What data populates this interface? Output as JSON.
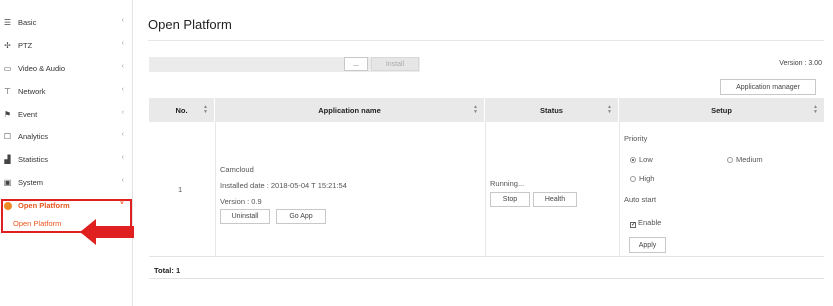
{
  "sidebar": {
    "items": [
      {
        "label": "Basic",
        "icon": "list-icon",
        "glyph": "☰"
      },
      {
        "label": "PTZ",
        "icon": "ptz-move-icon",
        "glyph": "✢"
      },
      {
        "label": "Video & Audio",
        "icon": "video-icon",
        "glyph": "▭"
      },
      {
        "label": "Network",
        "icon": "network-icon",
        "glyph": "⊤"
      },
      {
        "label": "Event",
        "icon": "event-icon",
        "glyph": "⚑"
      },
      {
        "label": "Analytics",
        "icon": "analytics-icon",
        "glyph": "☐"
      },
      {
        "label": "Statistics",
        "icon": "statistics-icon",
        "glyph": "▟"
      },
      {
        "label": "System",
        "icon": "system-icon",
        "glyph": "▣"
      },
      {
        "label": "Open Platform",
        "icon": "open-platform-icon",
        "glyph": ""
      }
    ],
    "chevron": "‹",
    "chevron_open": "˅",
    "sub_item": "Open Platform"
  },
  "page": {
    "title": "Open Platform"
  },
  "toolbar": {
    "browse_label": "...",
    "install_label": "Install",
    "version": "Version : 3.00",
    "app_manager_label": "Application manager"
  },
  "table": {
    "headers": {
      "no": "No.",
      "name": "Application name",
      "status": "Status",
      "setup": "Setup"
    },
    "row": {
      "no": "1",
      "app_name": "Camcloud",
      "installed_date": "Installed date : 2018-05-04 T 15:21:54",
      "version": "Version : 0.9",
      "uninstall_label": "Uninstall",
      "go_app_label": "Go App",
      "status": "Running...",
      "stop_label": "Stop",
      "health_label": "Health",
      "priority_label": "Priority",
      "priority_options": [
        "Low",
        "Medium",
        "High"
      ],
      "priority_selected": "Low",
      "auto_start_label": "Auto start",
      "enable_label": "Enable",
      "enable_checked": true,
      "apply_label": "Apply"
    },
    "total": "Total: 1"
  },
  "colors": {
    "accent": "#e8561f",
    "highlight": "#e02020",
    "header_bg": "#e9e9e9"
  }
}
